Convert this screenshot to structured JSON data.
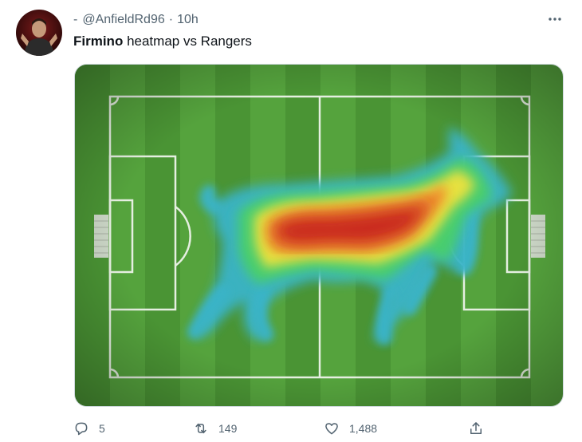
{
  "tweet": {
    "prefix": "-",
    "handle": "@AnfieldRd96",
    "separator": "·",
    "time": "10h",
    "text_bold": "Firmino",
    "text_rest": " heatmap vs Rangers",
    "more_icon": "more-horizontal-icon"
  },
  "media": {
    "description_icon": "heatmap-image",
    "colors": {
      "pitch_light": "#5cab43",
      "pitch_dark": "#4b9636",
      "heat_blue": "#3ab4c8",
      "heat_green": "#4fd36a",
      "heat_yellow": "#f1e33e",
      "heat_orange": "#f0912e",
      "heat_red": "#c9251d"
    }
  },
  "actions": {
    "reply": {
      "icon": "reply-icon",
      "count": "5"
    },
    "retweet": {
      "icon": "retweet-icon",
      "count": "149"
    },
    "like": {
      "icon": "heart-icon",
      "count": "1,488"
    },
    "share": {
      "icon": "share-icon"
    }
  }
}
